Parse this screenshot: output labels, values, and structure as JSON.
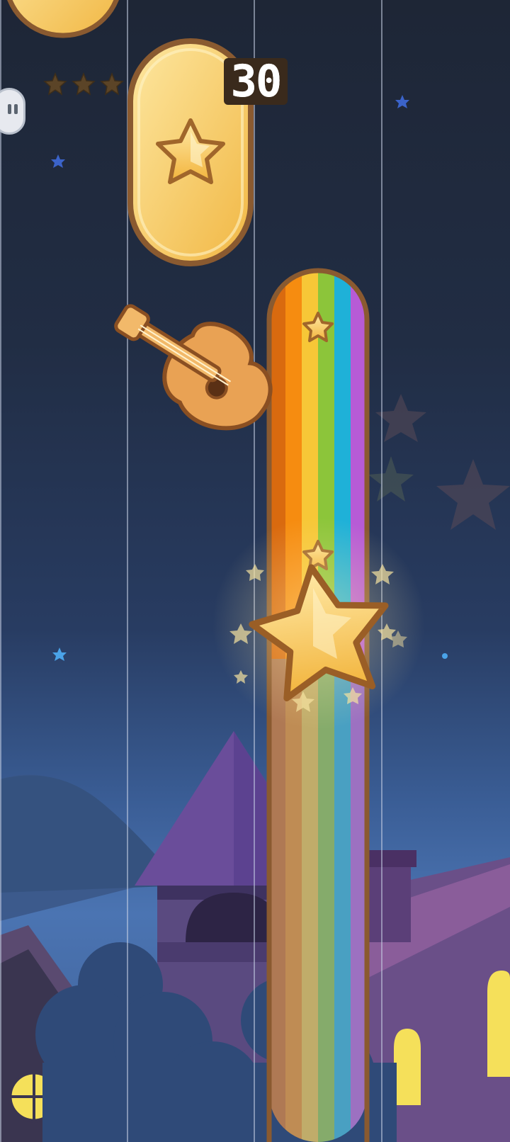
{
  "hud": {
    "score": "30",
    "stars_earned": 0,
    "stars_total": 3,
    "pause_icon": "pause-icon"
  },
  "scene": {
    "lanes": 4,
    "tiles": [
      {
        "lane": 1,
        "type": "gold-tile",
        "icon": "star-icon"
      },
      {
        "lane": 1,
        "type": "gold-tile-partial",
        "icon": "none"
      },
      {
        "lane": 2,
        "type": "rainbow-long-tile",
        "icon": "star-icon"
      }
    ],
    "decorations": [
      "guitar-icon",
      "big-star-icon",
      "church-tower",
      "houses",
      "bushes",
      "mountains"
    ],
    "colors": {
      "sky_top": "#1e2636",
      "sky_bottom": "#4b74b2",
      "tile_gold": "#f6c65a",
      "tile_border": "#8a5a30"
    }
  }
}
